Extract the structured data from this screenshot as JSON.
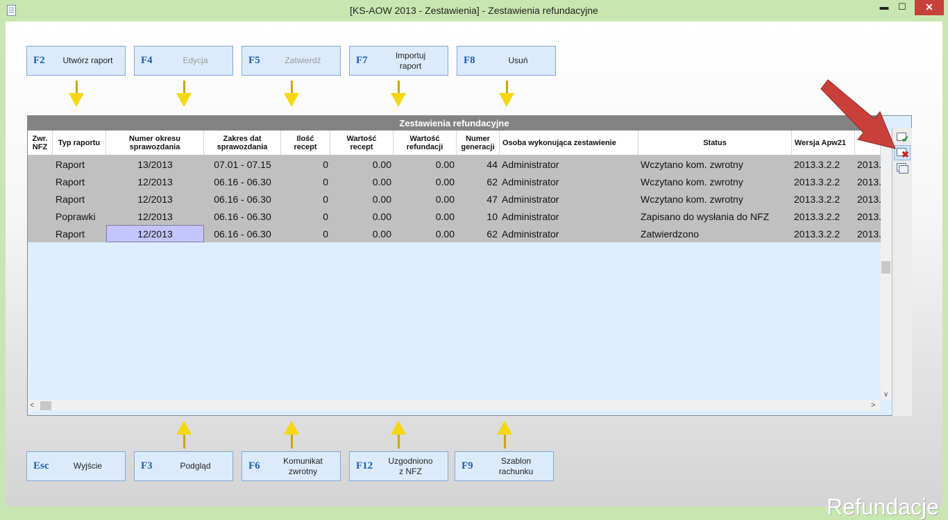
{
  "window": {
    "title": "[KS-AOW 2013 - Zestawienia] - Zestawienia refundacyjne",
    "min_label": "▬",
    "max_label": "☐",
    "close_label": "✕"
  },
  "top_buttons": [
    {
      "key": "F2",
      "label": "Utwórz raport",
      "enabled": true
    },
    {
      "key": "F4",
      "label": "Edycja",
      "enabled": false
    },
    {
      "key": "F5",
      "label": "Zatwierdź",
      "enabled": false
    },
    {
      "key": "F7",
      "label": "Importuj\nraport",
      "enabled": true
    },
    {
      "key": "F8",
      "label": "Usuń",
      "enabled": true
    }
  ],
  "bottom_buttons": [
    {
      "key": "Esc",
      "label": "Wyjście",
      "enabled": true
    },
    {
      "key": "F3",
      "label": "Podgląd",
      "enabled": true
    },
    {
      "key": "F6",
      "label": "Komunikat\nzwrotny",
      "enabled": true
    },
    {
      "key": "F12",
      "label": "Uzgodniono\nz NFZ",
      "enabled": true
    },
    {
      "key": "F9",
      "label": "Szablon\nrachunku",
      "enabled": true
    }
  ],
  "grid": {
    "caption": "Zestawienia refundacyjne",
    "columns": [
      {
        "label": "Zwr.\nNFZ"
      },
      {
        "label": "Typ raportu"
      },
      {
        "label": "Numer okresu\nsprawozdania"
      },
      {
        "label": "Zakres dat\nsprawozdania"
      },
      {
        "label": "Ilość\nrecept"
      },
      {
        "label": "Wartość\nrecept"
      },
      {
        "label": "Wartość\nrefundacji"
      },
      {
        "label": "Numer\ngeneracji"
      },
      {
        "label": "Osoba wykonująca zestawienie"
      },
      {
        "label": "Status"
      },
      {
        "label": "Wersja Apw21"
      },
      {
        "label": ""
      }
    ],
    "rows": [
      {
        "zwr": "",
        "typ": "Raport",
        "okres": "13/2013",
        "zakres": "07.01 - 07.15",
        "ilosc": "0",
        "wartosc": "0.00",
        "refundacja": "0.00",
        "generacja": "44",
        "osoba": "Administrator",
        "status": "Wczytano kom. zwrotny",
        "wersja": "2013.3.2.2",
        "extra": "2013."
      },
      {
        "zwr": "",
        "typ": "Raport",
        "okres": "12/2013",
        "zakres": "06.16 - 06.30",
        "ilosc": "0",
        "wartosc": "0.00",
        "refundacja": "0.00",
        "generacja": "62",
        "osoba": "Administrator",
        "status": "Wczytano kom. zwrotny",
        "wersja": "2013.3.2.2",
        "extra": "2013."
      },
      {
        "zwr": "",
        "typ": "Raport",
        "okres": "12/2013",
        "zakres": "06.16 - 06.30",
        "ilosc": "0",
        "wartosc": "0.00",
        "refundacja": "0.00",
        "generacja": "47",
        "osoba": "Administrator",
        "status": "Wczytano kom. zwrotny",
        "wersja": "2013.3.2.2",
        "extra": "2013."
      },
      {
        "zwr": "",
        "typ": "Poprawki",
        "okres": "12/2013",
        "zakres": "06.16 - 06.30",
        "ilosc": "0",
        "wartosc": "0.00",
        "refundacja": "0.00",
        "generacja": "10",
        "osoba": "Administrator",
        "status": "Zapisano do wysłania do NFZ",
        "wersja": "2013.3.2.2",
        "extra": "2013."
      },
      {
        "zwr": "",
        "typ": "Raport",
        "okres": "12/2013",
        "zakres": "06.16 - 06.30",
        "ilosc": "0",
        "wartosc": "0.00",
        "refundacja": "0.00",
        "generacja": "62",
        "osoba": "Administrator",
        "status": "Zatwierdzono",
        "wersja": "2013.3.2.2",
        "extra": "2013."
      }
    ],
    "selected_row": 4,
    "selected_field": "okres"
  },
  "side_tools": [
    {
      "name": "accept-icon",
      "mark": "✔",
      "color": "#2e9b2e"
    },
    {
      "name": "reject-icon",
      "mark": "✖",
      "color": "#d22020"
    },
    {
      "name": "windows-icon",
      "mark": "",
      "color": "#5a6f8a"
    }
  ],
  "watermark": "Refundacje",
  "colors": {
    "accent_key": "#1c5fb0",
    "arrow_yellow": "#f5d80f",
    "pointer_red": "#c9403a",
    "row_gray": "#c0c0c0",
    "selected_cell": "#c4c4ff"
  }
}
